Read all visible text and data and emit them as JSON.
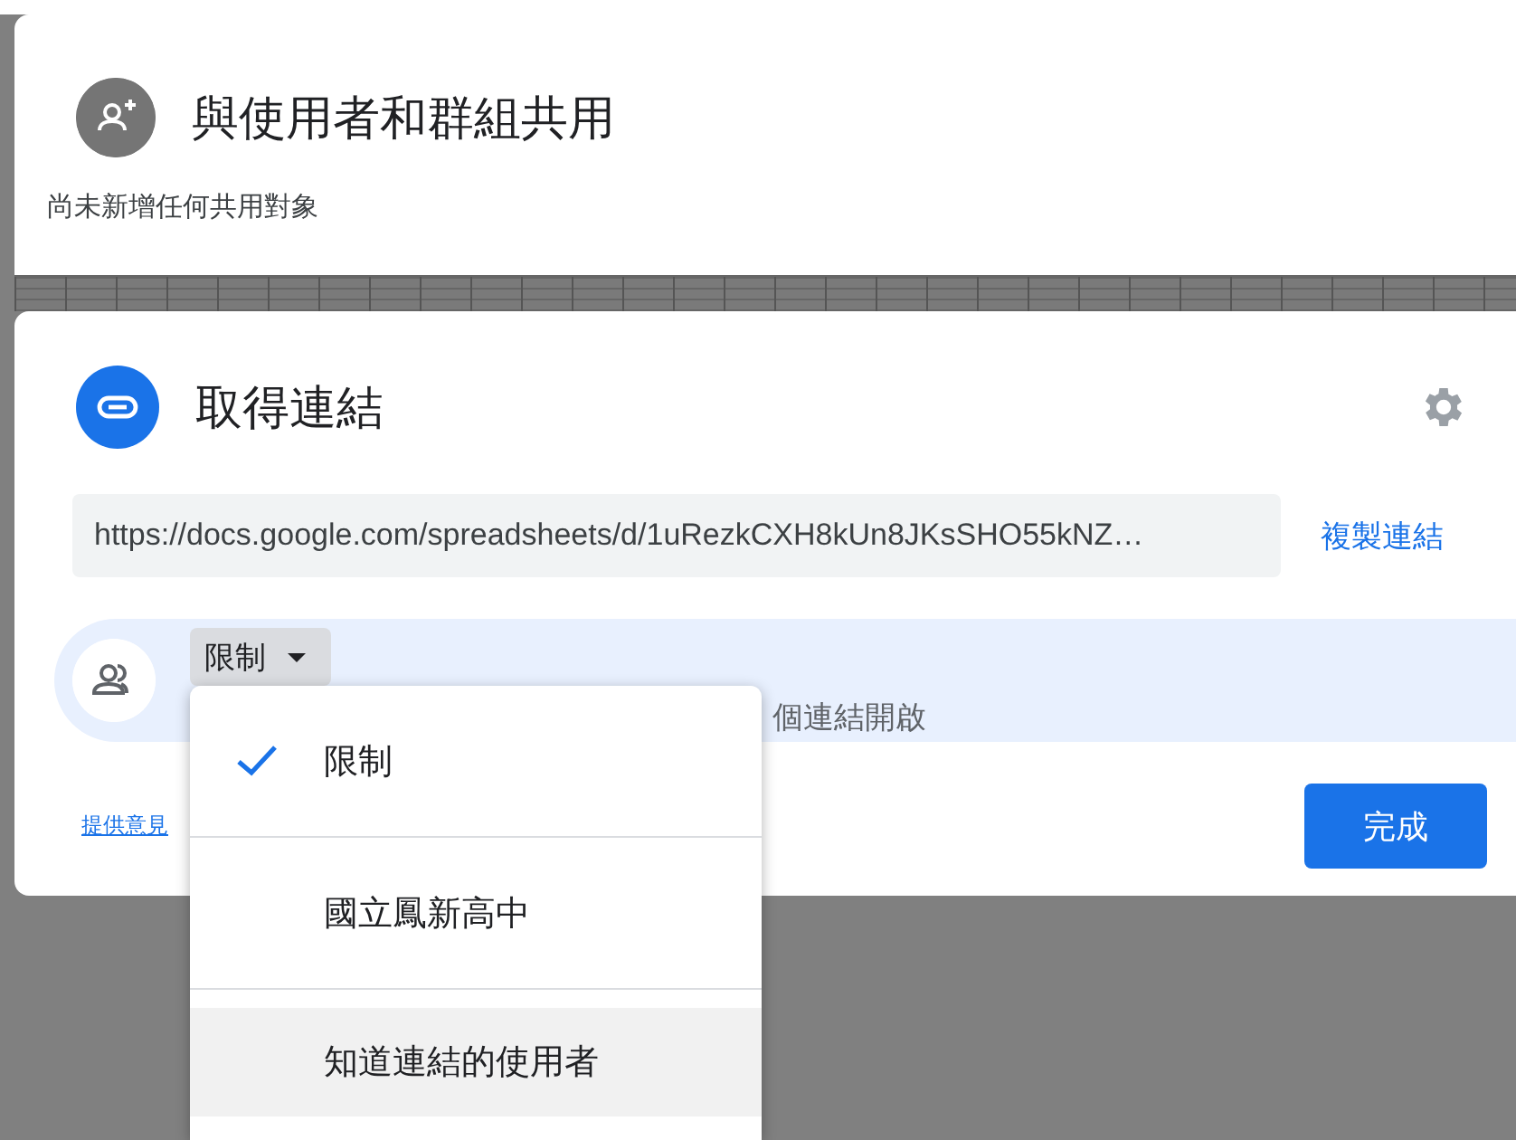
{
  "share_card": {
    "title": "與使用者和群組共用",
    "subtitle": "尚未新增任何共用對象"
  },
  "link_card": {
    "title": "取得連結",
    "url": "https://docs.google.com/spreadsheets/d/1uRezkCXH8kUn8JKsSHO55kNZ…",
    "copy_link": "複製連結",
    "access": {
      "dropdown": "限制",
      "description": "個連結開啟"
    },
    "feedback_link": "提供意見",
    "done_button": "完成"
  },
  "access_menu": [
    {
      "label": "限制",
      "selected": true,
      "hovered": false
    },
    {
      "label": "國立鳳新高中",
      "selected": false,
      "hovered": false
    },
    {
      "label": "知道連結的使用者",
      "selected": false,
      "hovered": true
    }
  ]
}
